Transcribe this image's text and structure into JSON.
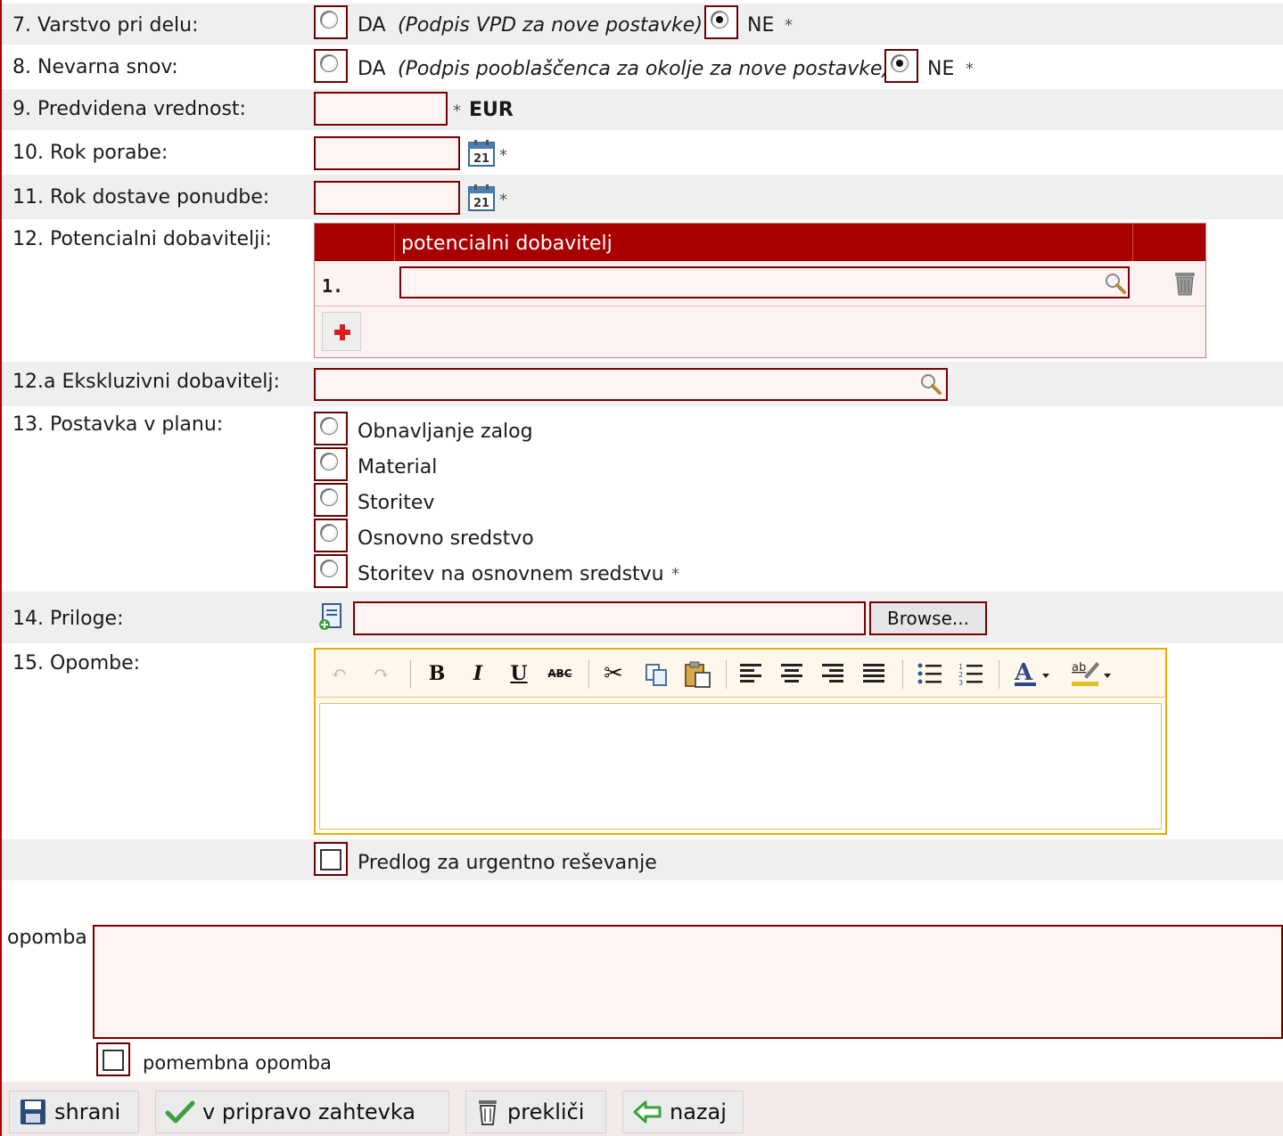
{
  "fields": {
    "f7": {
      "label": "7. Varstvo pri delu:",
      "da": "DA",
      "da_note": "(Podpis VPD za nove postavke)",
      "ne": "NE",
      "required": "*",
      "selected": "NE"
    },
    "f8": {
      "label": "8. Nevarna snov:",
      "da": "DA",
      "da_note": "(Podpis pooblaščenca za okolje za nove postavke)",
      "ne": "NE",
      "required": "*",
      "selected": "NE"
    },
    "f9": {
      "label": "9. Predvidena vrednost:",
      "value": "",
      "required": "*",
      "currency": "EUR"
    },
    "f10": {
      "label": "10. Rok porabe:",
      "value": "",
      "required": "*"
    },
    "f11": {
      "label": "11. Rok dostave ponudbe:",
      "value": "",
      "required": "*"
    },
    "f12": {
      "label": "12. Potencialni dobavitelji:",
      "column_header": "potencialni dobavitelj",
      "rows": [
        {
          "num": "1.",
          "value": ""
        }
      ]
    },
    "f12a": {
      "label": "12.a Ekskluzivni dobavitelj:",
      "value": ""
    },
    "f13": {
      "label": "13. Postavka v planu:",
      "options": [
        "Obnavljanje zalog",
        "Material",
        "Storitev",
        "Osnovno sredstvo",
        "Storitev na osnovnem sredstvu"
      ],
      "required": "*"
    },
    "f14": {
      "label": "14. Priloge:",
      "value": "",
      "browse": "Browse..."
    },
    "f15": {
      "label": "15. Opombe:",
      "toolbar": [
        "undo-icon",
        "redo-icon",
        "bold-icon",
        "italic-icon",
        "underline-icon",
        "strikethrough-icon",
        "cut-icon",
        "copy-icon",
        "paste-icon",
        "align-left-icon",
        "align-center-icon",
        "align-right-icon",
        "align-justify-icon",
        "bullet-list-icon",
        "numbered-list-icon",
        "font-color-icon",
        "highlight-color-icon"
      ]
    },
    "urgent": {
      "label": "Predlog za urgentno reševanje",
      "checked": false
    }
  },
  "note": {
    "label": "opomba",
    "value": "",
    "important_label": "pomembna opomba",
    "important_checked": false
  },
  "buttons": {
    "save": "shrani",
    "to_prep": "v pripravo zahtevka",
    "cancel": "prekliči",
    "back": "nazaj"
  },
  "colors": {
    "accent": "#a80000",
    "input_bg": "#fff4f4",
    "row_alt": "#efefef",
    "editor_border": "#f0a800"
  }
}
